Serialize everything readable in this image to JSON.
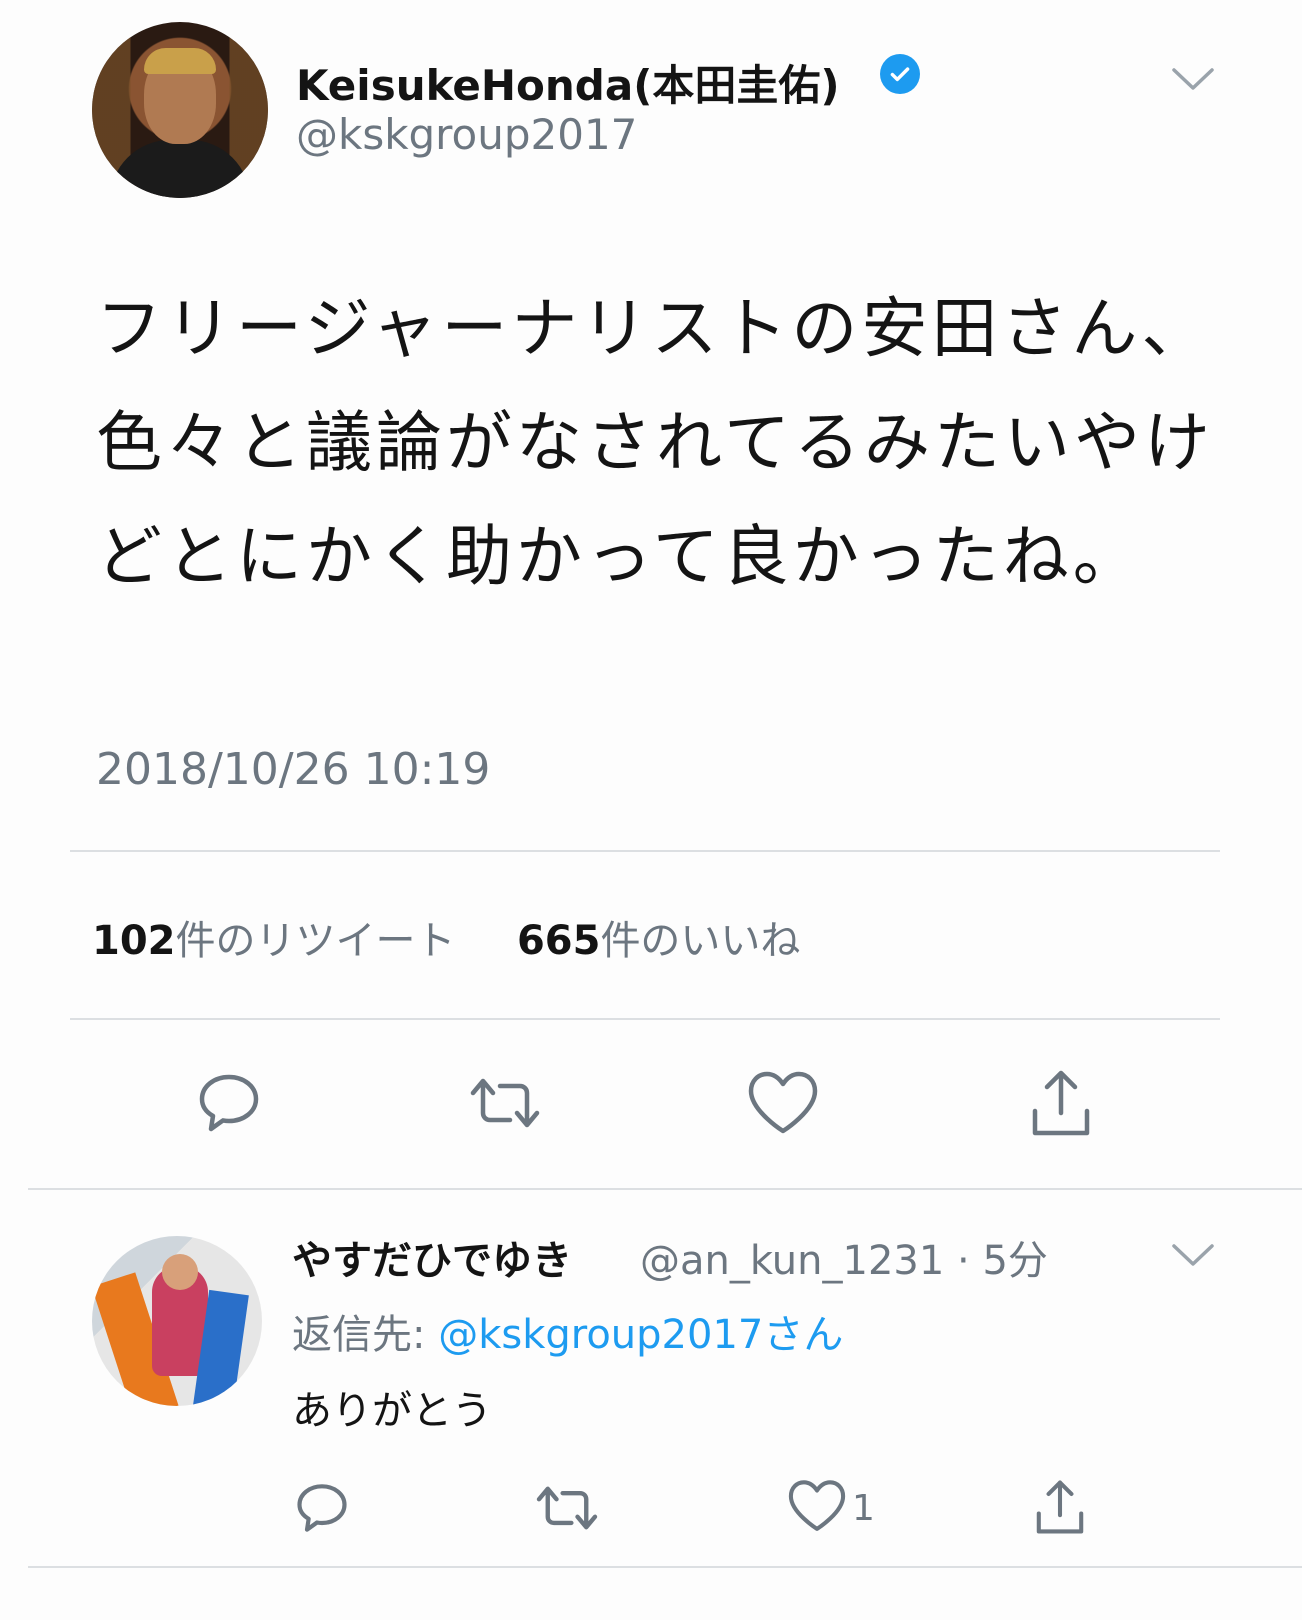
{
  "tweet": {
    "display_name": "KeisukeHonda(本田圭佑)",
    "handle": "@kskgroup2017",
    "text": "フリージャーナリストの安田さん、色々と議論がなされてるみたいやけどとにかく助かって良かったね。",
    "timestamp": "2018/10/26 10:19",
    "retweet_count": "102",
    "retweet_label": "件のリツイート",
    "like_count": "665",
    "like_label": "件のいいね"
  },
  "icons": {
    "verified": "verified-badge-icon",
    "menu": "chevron-down-icon",
    "reply": "reply-icon",
    "retweet": "retweet-icon",
    "like": "heart-icon",
    "share": "share-icon"
  },
  "reply": {
    "display_name": "やすだひでゆき",
    "handle_time": "@an_kun_1231 · 5分",
    "reply_to_prefix": "返信先: ",
    "reply_to_link": "@kskgroup2017さん",
    "text": "ありがとう",
    "like_count": "1"
  },
  "colors": {
    "accent": "#1d9bf0",
    "secondary_text": "#6c7680",
    "divider": "#dcdfe2"
  }
}
